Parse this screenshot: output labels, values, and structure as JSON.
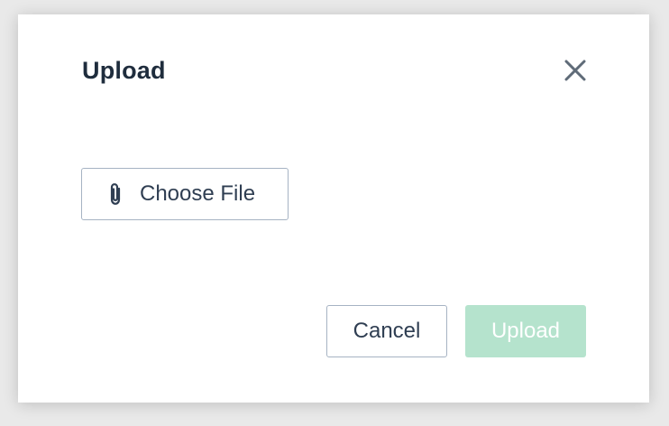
{
  "dialog": {
    "title": "Upload",
    "close_icon": "close-icon",
    "choose_file": {
      "label": "Choose File",
      "icon": "paperclip-icon"
    },
    "actions": {
      "cancel_label": "Cancel",
      "upload_label": "Upload",
      "upload_disabled": true
    }
  },
  "colors": {
    "title_text": "#1f2d3d",
    "button_text": "#2f3e52",
    "button_border": "#a6b3c3",
    "upload_disabled_bg": "#b5e3cd",
    "upload_text": "#ffffff",
    "backdrop": "#e9e9e9"
  }
}
